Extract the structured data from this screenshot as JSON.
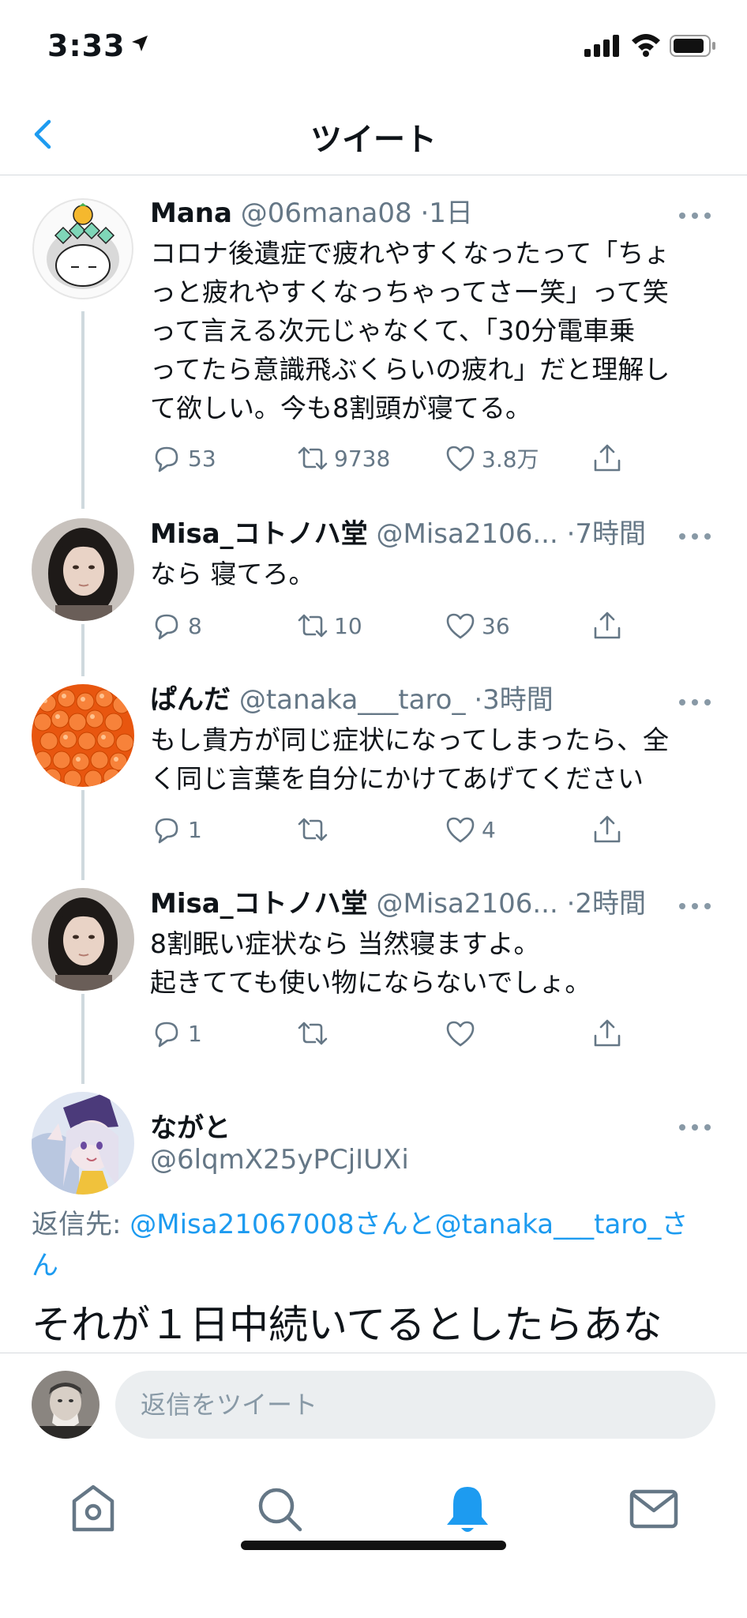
{
  "status_bar": {
    "time": "3:33",
    "location_icon": "location-arrow-icon",
    "signal_icon": "cellular-signal-icon",
    "wifi_icon": "wifi-icon",
    "battery_icon": "battery-icon"
  },
  "header": {
    "title": "ツイート",
    "back_icon": "chevron-left-icon",
    "accent_color": "#1d9bf0"
  },
  "thread": [
    {
      "name": "Mana",
      "handle": "@06mana08",
      "time": "·1日",
      "body": "コロナ後遺症で疲れやすくなったって「ちょ\nっと疲れやすくなっちゃってさー笑」って笑\nって言える次元じゃなくて、「30分電車乗\nってたら意識飛ぶくらいの疲れ」だと理解し\nて欲しい。今も8割頭が寝てる。",
      "replies": "53",
      "retweets": "9738",
      "likes": "3.8万"
    },
    {
      "name": "Misa_コトノハ堂",
      "handle": "@Misa2106...",
      "time": "·7時間",
      "body": "なら 寝てろ。",
      "replies": "8",
      "retweets": "10",
      "likes": "36"
    },
    {
      "name": "ぱんだ",
      "handle": "@tanaka___taro_",
      "time": "·3時間",
      "body": "もし貴方が同じ症状になってしまったら、全\nく同じ言葉を自分にかけてあげてください",
      "replies": "1",
      "retweets": "",
      "likes": "4"
    },
    {
      "name": "Misa_コトノハ堂",
      "handle": "@Misa2106...",
      "time": "·2時間",
      "body": "8割眠い症状なら 当然寝ますよ。\n起きてても使い物にならないでしょ。",
      "replies": "1",
      "retweets": "",
      "likes": ""
    }
  ],
  "main_tweet": {
    "name": "ながと",
    "handle": "@6lqmX25yPCjIUXi",
    "reply_prefix": "返信先: ",
    "reply_link_1": "@Misa21067008さんと",
    "reply_link_2": "@tanaka___taro_さ",
    "reply_link_3": "ん",
    "body": "それが１日中続いてるとしたらあな"
  },
  "composer": {
    "placeholder": "返信をツイート"
  },
  "tabbar": {
    "items": [
      "home-icon",
      "search-icon",
      "notifications-bell-icon",
      "messages-envelope-icon"
    ],
    "active": "notifications-bell-icon"
  },
  "icons": {
    "reply": "reply-bubble-icon",
    "retweet": "retweet-icon",
    "like": "heart-icon",
    "share": "share-icon",
    "more": "more-dots-icon"
  }
}
